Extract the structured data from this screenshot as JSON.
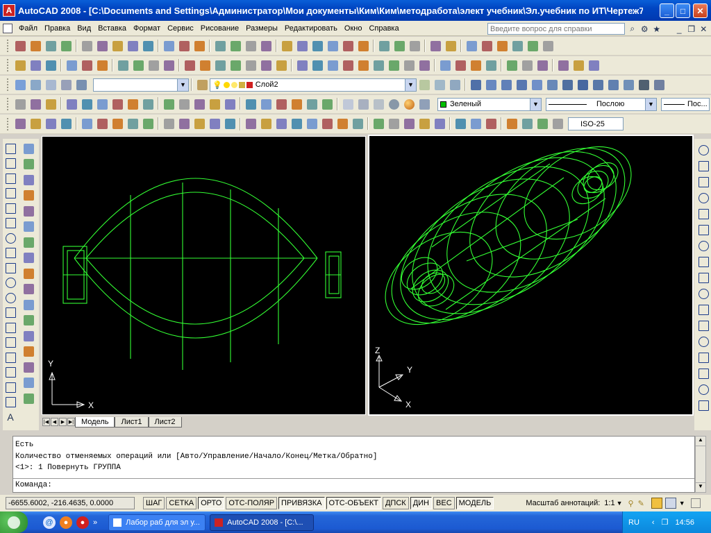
{
  "window": {
    "title": "AutoCAD 2008 - [C:\\Documents and Settings\\Администратор\\Мои документы\\Ким\\Ким\\методработа\\элект учебник\\Эл.учебник по ИТ\\Чертеж7...",
    "app_icon": "А"
  },
  "menu": {
    "items": [
      "Файл",
      "Правка",
      "Вид",
      "Вставка",
      "Формат",
      "Сервис",
      "Рисование",
      "Размеры",
      "Редактировать",
      "Окно",
      "Справка"
    ],
    "help_placeholder": "Введите вопрос для справки"
  },
  "toolbars": {
    "layer_combo": "Слой2",
    "color_combo": "Зеленый",
    "linetype_combo": "Послою",
    "lineweight_combo": "Пос...",
    "dimstyle_combo": "ISO-25",
    "layer_color": "#d02020",
    "green": "#00c000"
  },
  "viewports": {
    "left": {
      "axis_x": "X",
      "axis_y": "Y",
      "wire_color": "#33ff33"
    },
    "right": {
      "axis_x": "X",
      "axis_y": "Y",
      "axis_z": "Z",
      "wire_color": "#33ff33"
    }
  },
  "layout_tabs": [
    "Модель",
    "Лист1",
    "Лист2"
  ],
  "command": {
    "lines": [
      "Есть",
      "Количество отменяемых операций или [Авто/Управление/Начало/Конец/Метка/Обратно]",
      "<1>: 1 Повернуть ГРУППА"
    ],
    "prompt": "Команда:"
  },
  "status": {
    "coords": "-6655.6002, -216.4635, 0.0000",
    "buttons": [
      "ШАГ",
      "СЕТКА",
      "ОРТО",
      "ОТС-ПОЛЯР",
      "ПРИВЯЗКА",
      "ОТС-ОБЪЕКТ",
      "ДПСК",
      "ДИН",
      "ВЕС",
      "МОДЕЛЬ"
    ],
    "annotation_label": "Масштаб аннотаций:",
    "annotation_scale": "1:1"
  },
  "taskbar": {
    "tasks": [
      "Лабор раб для эл у...",
      "AutoCAD 2008 - [C:\\..."
    ],
    "lang": "RU",
    "clock": "14:56"
  }
}
